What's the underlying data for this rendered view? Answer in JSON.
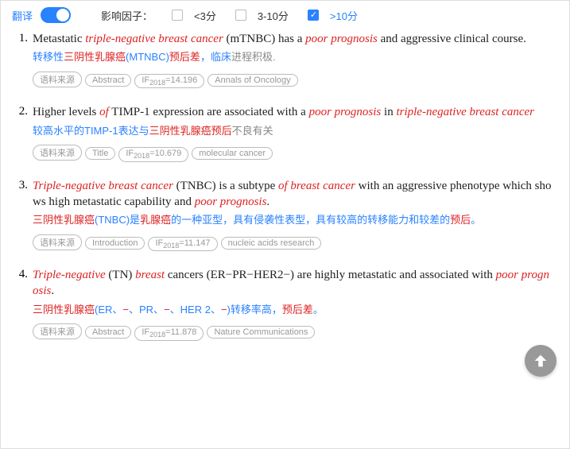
{
  "topbar": {
    "translate_label": "翻译",
    "factor_label": "影响因子：",
    "options": [
      {
        "label": "<3分",
        "checked": false
      },
      {
        "label": "3-10分",
        "checked": false
      },
      {
        "label": ">10分",
        "checked": true
      }
    ]
  },
  "results": [
    {
      "num": "1.",
      "en_parts": [
        {
          "t": "Metastatic "
        },
        {
          "t": "triple-negative breast cancer",
          "hl": true
        },
        {
          "t": " (mTNBC) has a "
        },
        {
          "t": "poor prognosis",
          "hl": true
        },
        {
          "t": " and aggressive clinical course."
        }
      ],
      "zh_parts": [
        {
          "t": "转移性"
        },
        {
          "t": "三阴性乳腺癌",
          "c": "red"
        },
        {
          "t": "(MTNBC)"
        },
        {
          "t": "预后差",
          "c": "red"
        },
        {
          "t": "，临床"
        },
        {
          "t": "进程积极.",
          "c": "gray"
        }
      ],
      "tags": [
        "语料来源",
        "Abstract",
        "IF₂₀₁₈=14.196",
        "Annals of Oncology"
      ]
    },
    {
      "num": "2.",
      "en_parts": [
        {
          "t": "Higher levels "
        },
        {
          "t": "of",
          "hl": true
        },
        {
          "t": " TIMP-1 expression are associated with a "
        },
        {
          "t": "poor prognosis",
          "hl": true
        },
        {
          "t": " in "
        },
        {
          "t": "triple-negative breast cancer",
          "hl": true
        }
      ],
      "zh_parts": [
        {
          "t": "较高水平的TIMP-1表达与"
        },
        {
          "t": "三阴性乳腺癌预后",
          "c": "red"
        },
        {
          "t": "不良有关",
          "c": "gray"
        }
      ],
      "tags": [
        "语料来源",
        "Title",
        "IF₂₀₁₈=10.679",
        "molecular cancer"
      ]
    },
    {
      "num": "3.",
      "en_parts": [
        {
          "t": "Triple-negative breast cancer",
          "hl": true
        },
        {
          "t": " (TNBC) is a subtype "
        },
        {
          "t": "of breast cancer",
          "hl": true
        },
        {
          "t": " with an aggressive phenotype which shows high metastatic capability and "
        },
        {
          "t": "poor prognosis",
          "hl": true
        },
        {
          "t": "."
        }
      ],
      "zh_parts": [
        {
          "t": "三阴性乳腺癌",
          "c": "red"
        },
        {
          "t": "(TNBC)是"
        },
        {
          "t": "乳腺癌",
          "c": "red"
        },
        {
          "t": "的一种亚型，具有侵袭性表型，具有较高的转移能力和较差的"
        },
        {
          "t": "预后",
          "c": "red"
        },
        {
          "t": "。"
        }
      ],
      "tags": [
        "语料来源",
        "Introduction",
        "IF₂₀₁₈=11.147",
        "nucleic acids research"
      ]
    },
    {
      "num": "4.",
      "en_parts": [
        {
          "t": "Triple-negative",
          "hl": true
        },
        {
          "t": " (TN) "
        },
        {
          "t": "breast",
          "hl": true
        },
        {
          "t": " cancers (ER−PR−HER2−) are highly metastatic and associated with "
        },
        {
          "t": "poor prognosis",
          "hl": true
        },
        {
          "t": "."
        }
      ],
      "zh_parts": [
        {
          "t": "三阴性乳腺癌",
          "c": "red"
        },
        {
          "t": "(ER、"
        },
        {
          "t": "−",
          "c": "red"
        },
        {
          "t": "、PR、"
        },
        {
          "t": "−",
          "c": "red"
        },
        {
          "t": "、HER 2、"
        },
        {
          "t": "−",
          "c": "red"
        },
        {
          "t": ")转移率高，"
        },
        {
          "t": "预后差",
          "c": "red"
        },
        {
          "t": "。"
        }
      ],
      "tags": [
        "语料来源",
        "Abstract",
        "IF₂₀₁₈=11.878",
        "Nature Communications"
      ]
    }
  ]
}
